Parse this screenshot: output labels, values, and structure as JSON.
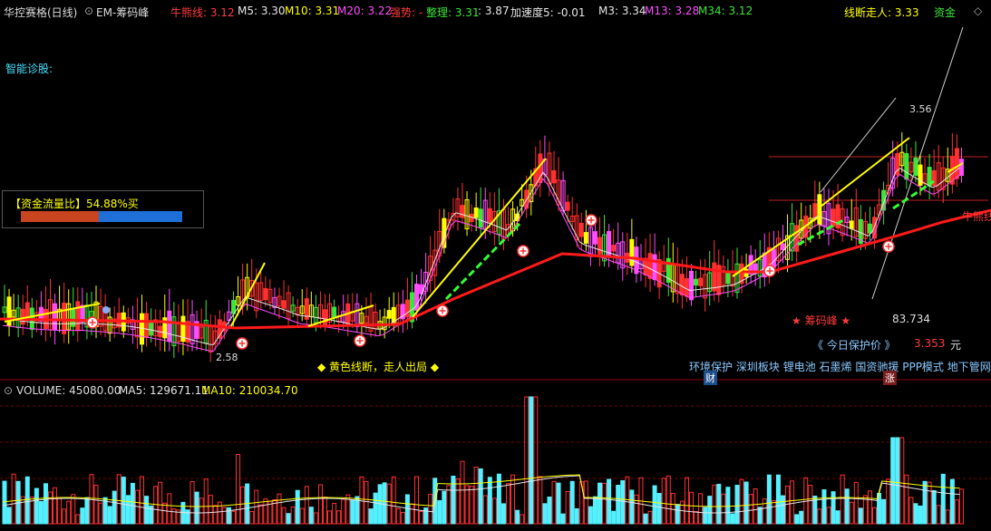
{
  "header": {
    "stock_title": "华控赛格(日线)",
    "indicator_name": "EM-筹码峰",
    "niuxiong_label": "牛熊线: 3.12",
    "m5": "M5: 3.30",
    "m10": "M10: 3.31",
    "m20": "M20: 3.22",
    "qiangshi": "强势: -",
    "zhengli": "整理: 3.31",
    "value_387": ": 3.87",
    "jiasudu": "加速度5: -0.01",
    "m3": "M3: 3.34",
    "m13": "M13: 3.28",
    "m34": "M34: 3.12",
    "xianduan": "线断走人: 3.33",
    "zijin": "资金",
    "colors": {
      "red": "#ff3b3b",
      "white": "#e6e6e6",
      "yellow": "#ffff00",
      "magenta": "#ff4dff",
      "green": "#39e639",
      "cyan": "#44e0ff"
    }
  },
  "main": {
    "diagnosis_label": "智能诊股:",
    "flow_label": "【资金流量比】54.88%买",
    "flow_buy_ratio": 0.5488,
    "low_price_label": "2.58",
    "high_price_label": "3.56",
    "chip_peak_label": "★ 筹码峰 ★",
    "chip_peak_value": "83.734",
    "protect_label": "《 今日保护价 》",
    "protect_value": "3.353",
    "protect_unit": "元",
    "yellow_break_label": "◆ 黄色线断，走人出局 ◆",
    "niuxiong_right_label": "牛熊线",
    "plates": [
      "环境保护",
      "深圳板块",
      "锂电池",
      "石墨烯",
      "国资驰援",
      "PPP模式",
      "地下管网"
    ],
    "plate_tags": {
      "cai": "财",
      "zhang": "涨"
    }
  },
  "volume": {
    "title": "VOLUME: 45080.00",
    "ma5": "MA5: 129671.11",
    "ma10": "MA10: 210034.70"
  }
}
